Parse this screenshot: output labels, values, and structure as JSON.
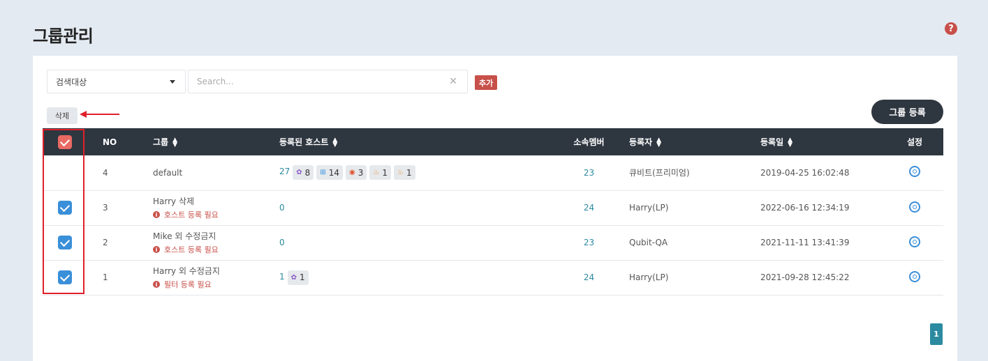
{
  "page": {
    "title": "그룹관리",
    "help_icon": "question-circle-icon"
  },
  "search": {
    "target_label": "검색대상",
    "placeholder": "Search...",
    "clear_icon": "close-icon",
    "add_label": "추가"
  },
  "actions": {
    "delete_label": "삭제",
    "register_label": "그룹 등록"
  },
  "table": {
    "headers": {
      "no": "NO",
      "group": "그룹",
      "hosts": "등록된 호스트",
      "members": "소속멤버",
      "registrant": "등록자",
      "date": "등록일",
      "settings": "설정"
    },
    "rows": [
      {
        "checked": false,
        "no": "4",
        "group": "default",
        "warning": "",
        "host_total": "27",
        "badges": [
          {
            "icon": "linux-icon",
            "count": "8"
          },
          {
            "icon": "windows-icon",
            "count": "14"
          },
          {
            "icon": "ubuntu-icon",
            "count": "3"
          },
          {
            "icon": "fire-icon",
            "count": "1"
          },
          {
            "icon": "fire-icon",
            "count": "1"
          }
        ],
        "members": "23",
        "registrant": "큐비트(프리미엄)",
        "date": "2019-04-25 16:02:48"
      },
      {
        "checked": true,
        "no": "3",
        "group": "Harry 삭제",
        "warning": "호스트 등록 필요",
        "host_total": "0",
        "badges": [],
        "members": "24",
        "registrant": "Harry(LP)",
        "date": "2022-06-16 12:34:19"
      },
      {
        "checked": true,
        "no": "2",
        "group": "Mike 외 수정금지",
        "warning": "호스트 등록 필요",
        "host_total": "0",
        "badges": [],
        "members": "23",
        "registrant": "Qubit-QA",
        "date": "2021-11-11 13:41:39"
      },
      {
        "checked": true,
        "no": "1",
        "group": "Harry 외 수정금지",
        "warning": "필터 등록 필요",
        "host_total": "1",
        "badges": [
          {
            "icon": "linux-icon",
            "count": "1"
          }
        ],
        "members": "24",
        "registrant": "Harry(LP)",
        "date": "2021-09-28 12:45:22"
      }
    ]
  },
  "pagination": {
    "current": "1"
  },
  "colors": {
    "accent": "#2b8aa0",
    "danger": "#c8504a",
    "header_bg": "#2e3640",
    "check": "#3a8fd9"
  }
}
